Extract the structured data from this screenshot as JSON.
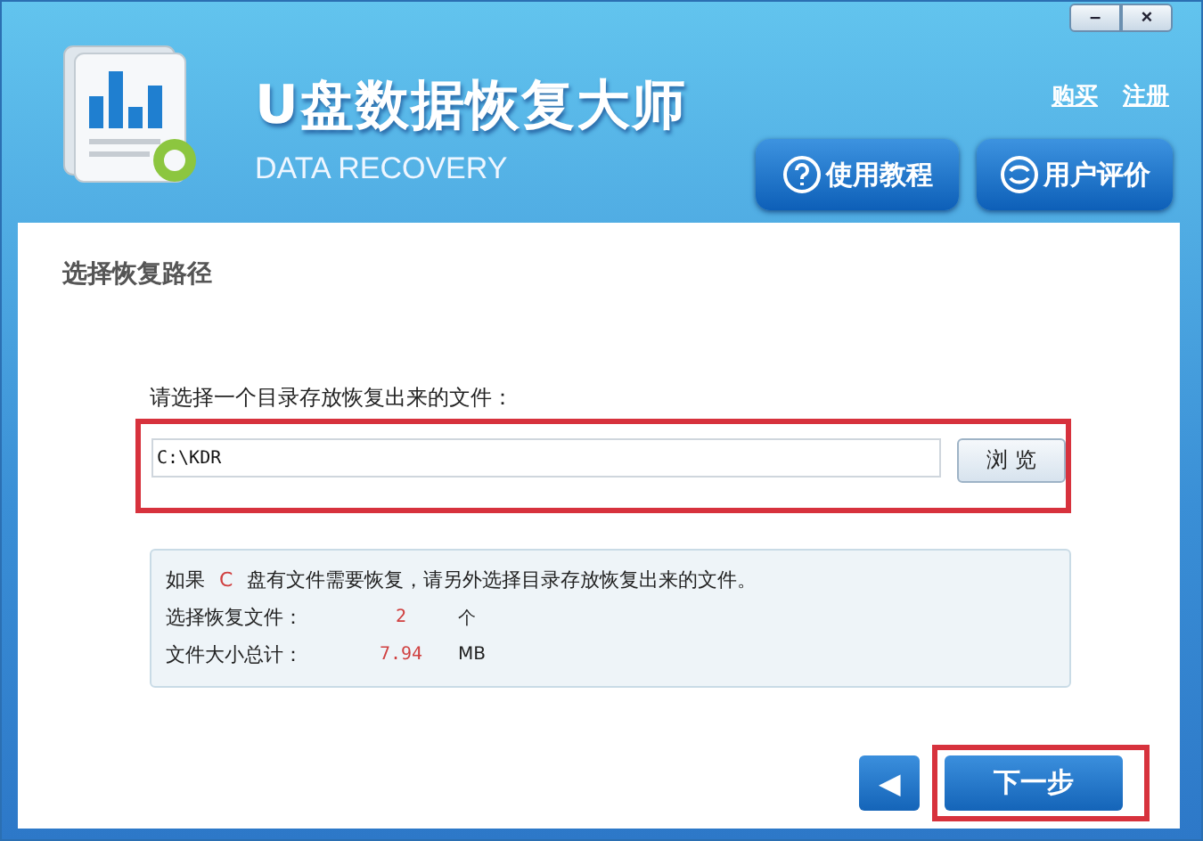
{
  "window": {
    "controls": [
      {
        "kind": "minimize",
        "label": "–"
      },
      {
        "kind": "close",
        "label": "×"
      }
    ]
  },
  "header": {
    "title": "U盘数据恢复大师",
    "subtitle": "DATA RECOVERY",
    "links": [
      "购买",
      "注册"
    ],
    "buttons": [
      {
        "kind": "help",
        "label": "使用教程"
      },
      {
        "kind": "review",
        "label": "用户评价"
      }
    ]
  },
  "section_title": "选择恢复路径",
  "path": {
    "label": "请选择一个目录存放恢复出来的文件：",
    "value": "C:\\KDR",
    "browse": "浏 览",
    "highlighted": true
  },
  "info": {
    "notice": {
      "prefix": "如果",
      "drive": "C",
      "suffix": "盘有文件需要恢复，请另外选择目录存放恢复出来的文件。"
    },
    "rows": [
      {
        "label": "选择恢复文件：",
        "value": "2",
        "unit": "个"
      },
      {
        "label": "文件大小总计：",
        "value": "7.94",
        "unit": "MB"
      }
    ]
  },
  "footer": {
    "back": "◀",
    "next": "下一步",
    "next_highlighted": true
  }
}
